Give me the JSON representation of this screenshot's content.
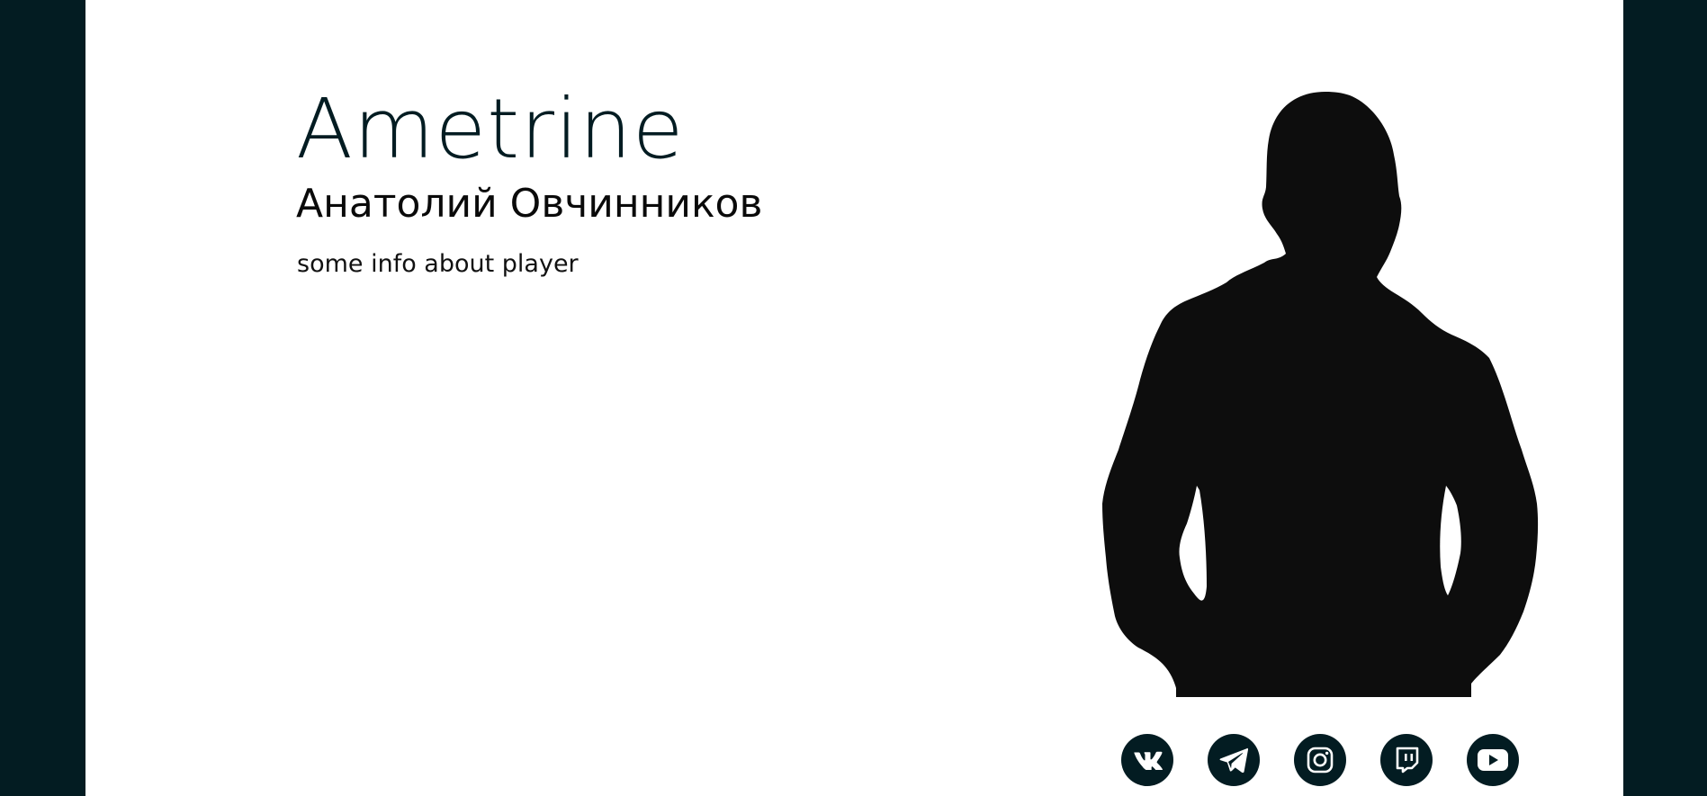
{
  "player": {
    "nickname": "Ametrine",
    "real_name": "Анатолий Овчинников",
    "info": "some info about player"
  },
  "socials": [
    {
      "icon": "vk-icon"
    },
    {
      "icon": "telegram-icon"
    },
    {
      "icon": "instagram-icon"
    },
    {
      "icon": "twitch-icon"
    },
    {
      "icon": "youtube-icon"
    }
  ],
  "colors": {
    "background": "#031c22",
    "panel": "#ffffff",
    "silhouette": "#0d0d0d",
    "icon_bg": "#031c22"
  }
}
